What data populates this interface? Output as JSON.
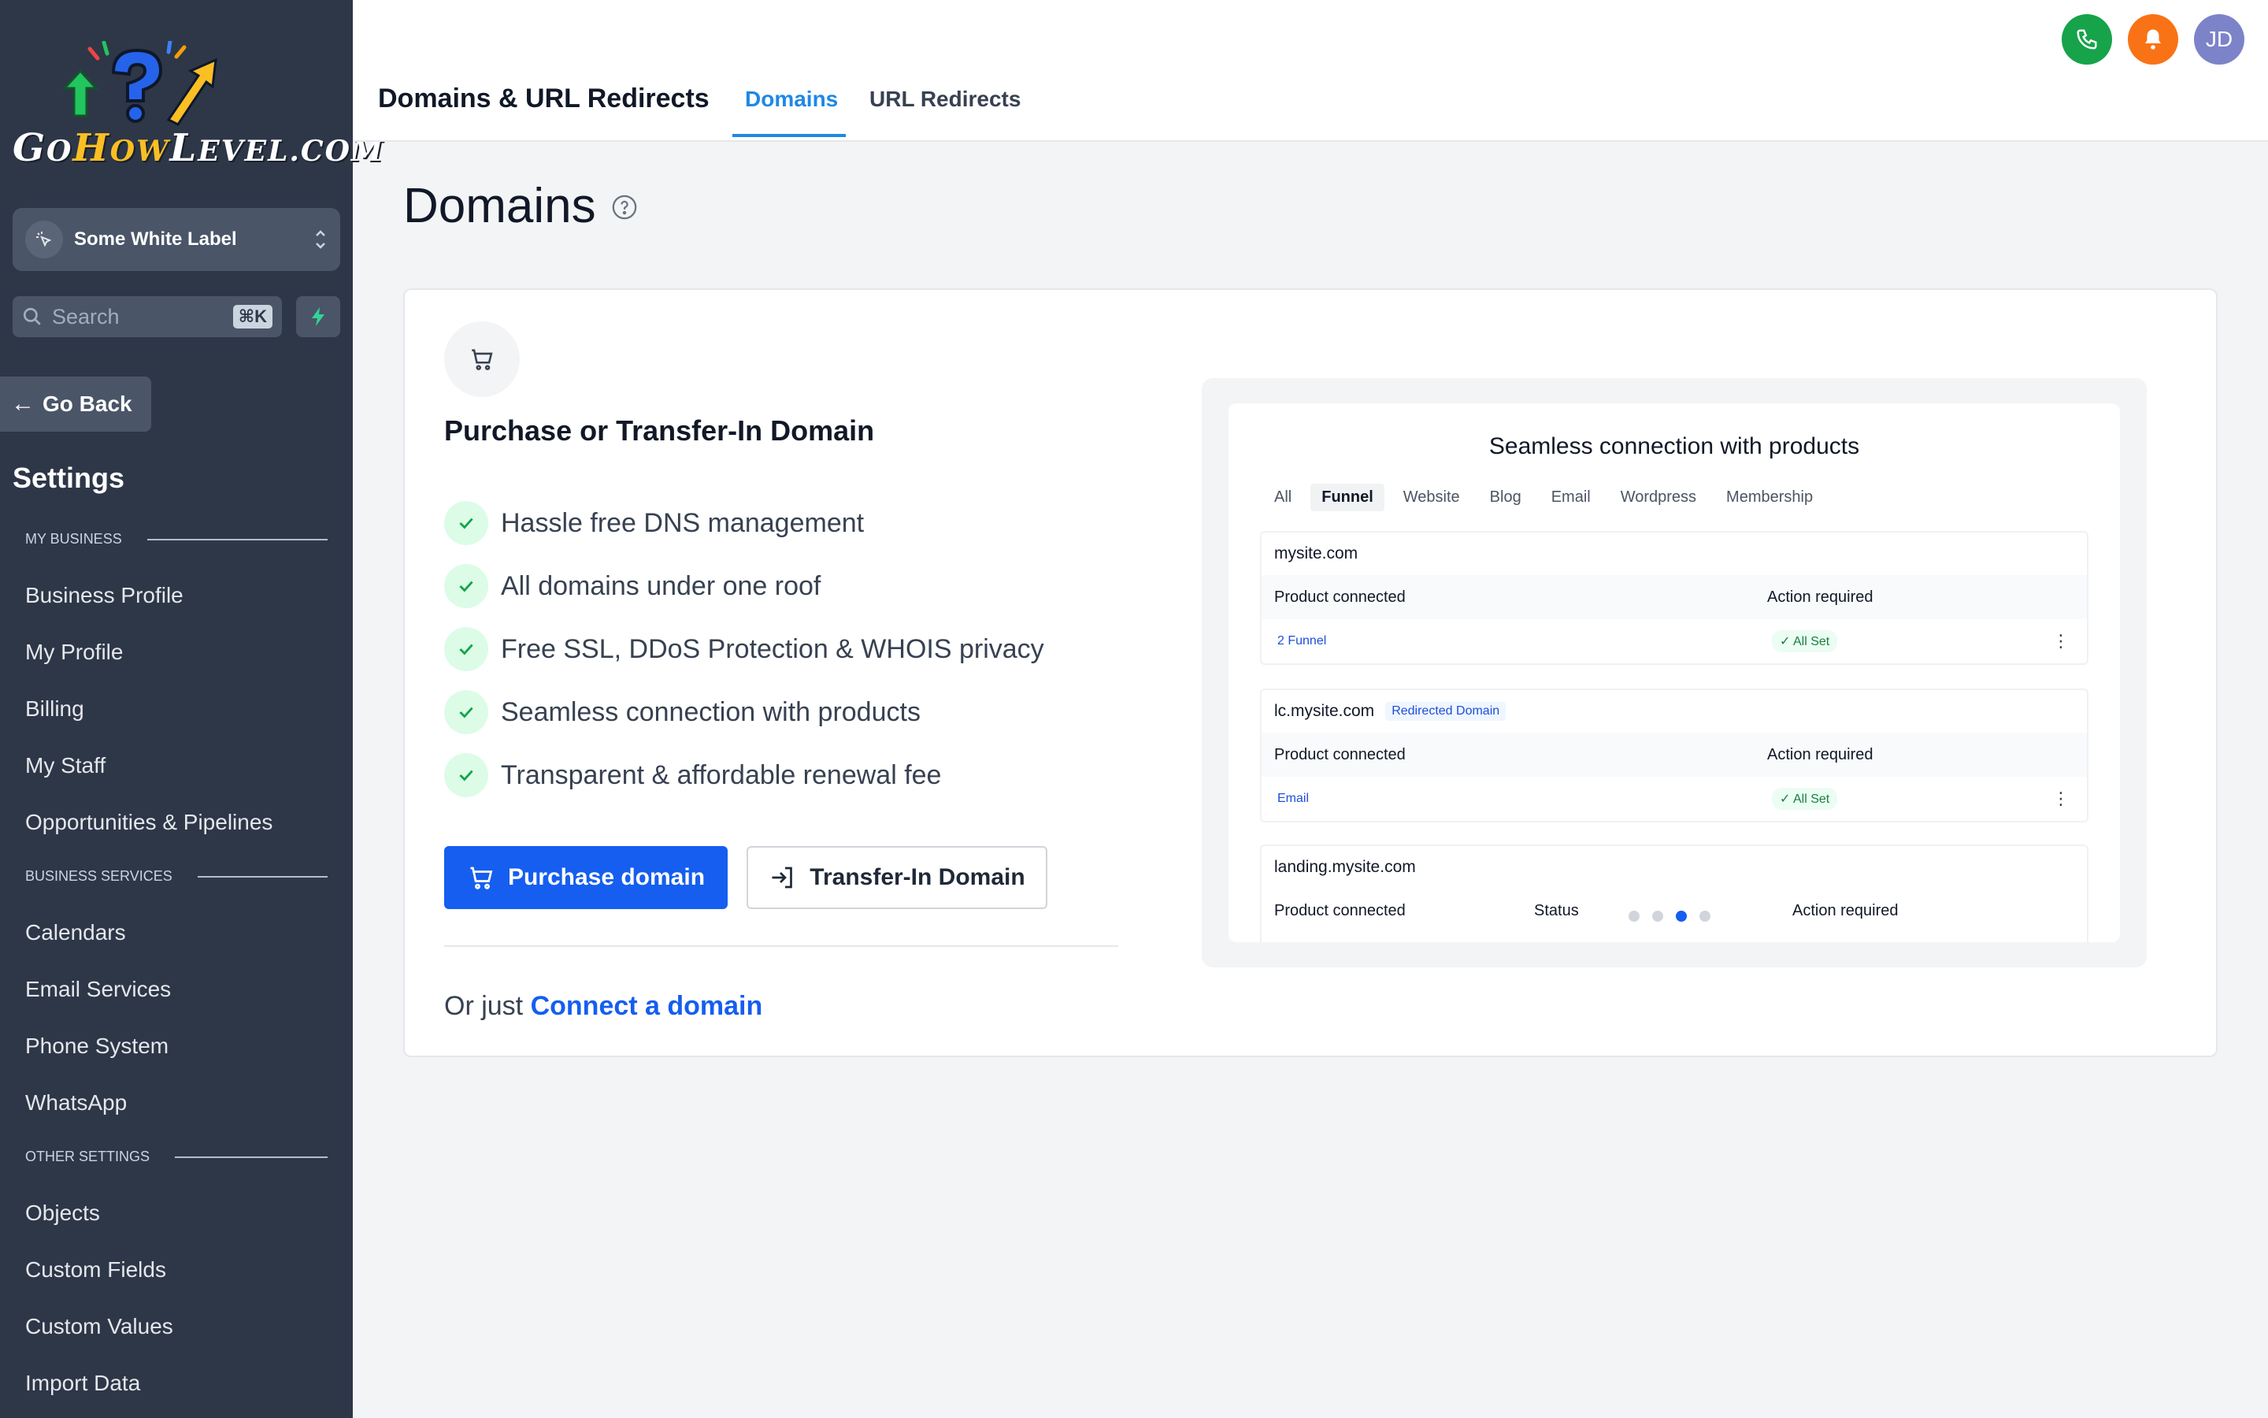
{
  "sidebar": {
    "logo_text": "GoHowLevel.com",
    "location": "Some White Label",
    "search_placeholder": "Search",
    "search_shortcut": "⌘K",
    "go_back": "Go Back",
    "settings_title": "Settings",
    "sections": {
      "my_business": "MY BUSINESS",
      "business_services": "BUSINESS SERVICES",
      "other_settings": "OTHER SETTINGS"
    },
    "items": {
      "business_profile": "Business Profile",
      "my_profile": "My Profile",
      "billing": "Billing",
      "my_staff": "My Staff",
      "opportunities": "Opportunities & Pipelines",
      "calendars": "Calendars",
      "email_services": "Email Services",
      "phone_system": "Phone System",
      "whatsapp": "WhatsApp",
      "objects": "Objects",
      "custom_fields": "Custom Fields",
      "custom_values": "Custom Values",
      "import_data": "Import Data"
    }
  },
  "header": {
    "title": "Domains & URL Redirects",
    "tabs": [
      "Domains",
      "URL Redirects"
    ],
    "active_tab": "Domains",
    "avatar_initials": "JD"
  },
  "main": {
    "page_title": "Domains",
    "card_heading": "Purchase or Transfer-In Domain",
    "features": [
      "Hassle free DNS management",
      "All domains under one roof",
      "Free SSL, DDoS Protection & WHOIS privacy",
      "Seamless connection with products",
      "Transparent & affordable renewal fee"
    ],
    "purchase_button": "Purchase domain",
    "transfer_button": "Transfer-In Domain",
    "or_just": "Or just",
    "connect_link": "Connect a domain"
  },
  "preview": {
    "title": "Seamless connection with products",
    "tabs": [
      "All",
      "Funnel",
      "Website",
      "Blog",
      "Email",
      "Wordpress",
      "Membership"
    ],
    "active_tab": "Funnel",
    "product_connected": "Product connected",
    "action_required": "Action required",
    "status": "Status",
    "all_set": "All Set",
    "cards": [
      {
        "domain": "mysite.com",
        "badge": "",
        "product": "2 Funnel"
      },
      {
        "domain": "lc.mysite.com",
        "badge": "Redirected Domain",
        "product": "Email"
      },
      {
        "domain": "landing.mysite.com",
        "badge": "",
        "product": ""
      }
    ],
    "carousel_active_index": 2,
    "carousel_count": 4
  },
  "colors": {
    "sidebar_bg": "#2d3748",
    "accent_blue": "#155eef",
    "tab_blue": "#1e88e5",
    "phone_green": "#16a34a",
    "bell_orange": "#f97316",
    "avatar": "#7c83c9"
  }
}
